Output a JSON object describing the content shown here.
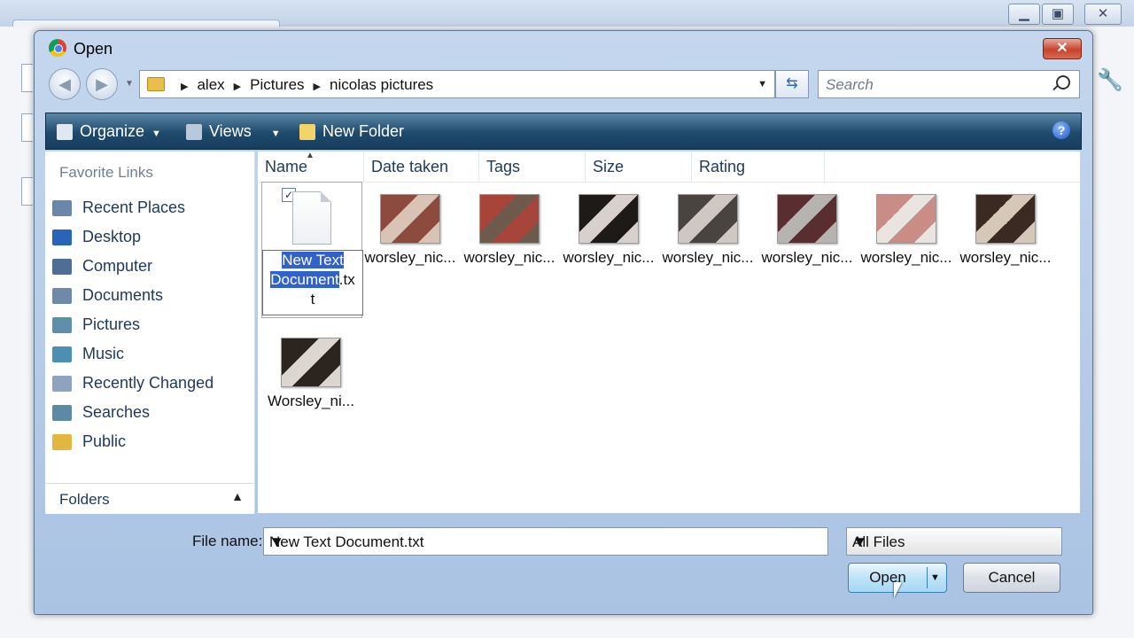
{
  "dialog": {
    "title": "Open",
    "close_label": "✕"
  },
  "nav": {
    "breadcrumb": [
      "alex",
      "Pictures",
      "nicolas pictures"
    ],
    "search_placeholder": "Search"
  },
  "toolbar": {
    "organize": "Organize",
    "views": "Views",
    "new_folder": "New Folder"
  },
  "left_pane": {
    "favorite_links_heading": "Favorite Links",
    "items": [
      {
        "label": "Recent Places",
        "icon": "recent-places-icon",
        "color": "#6a86a8"
      },
      {
        "label": "Desktop",
        "icon": "desktop-icon",
        "color": "#2a64b8"
      },
      {
        "label": "Computer",
        "icon": "computer-icon",
        "color": "#4d6f95"
      },
      {
        "label": "Documents",
        "icon": "documents-icon",
        "color": "#6e8aa8"
      },
      {
        "label": "Pictures",
        "icon": "pictures-icon",
        "color": "#5f8fa8"
      },
      {
        "label": "Music",
        "icon": "music-icon",
        "color": "#4d8fb0"
      },
      {
        "label": "Recently Changed",
        "icon": "recently-changed-icon",
        "color": "#8ea3be"
      },
      {
        "label": "Searches",
        "icon": "searches-icon",
        "color": "#5c8aa4"
      },
      {
        "label": "Public",
        "icon": "public-folder-icon",
        "color": "#e2b640"
      }
    ],
    "folders_label": "Folders"
  },
  "columns": [
    "Name",
    "Date taken",
    "Tags",
    "Size",
    "Rating"
  ],
  "files": {
    "selected": {
      "rename_highlight": "New Text Document",
      "rename_rest_line2": ".tx",
      "rename_rest_line3": "t"
    },
    "thumbs": [
      {
        "name": "worsley_nic...",
        "c1": "#8d4a3e",
        "c2": "#d9c3b5"
      },
      {
        "name": "worsley_nic...",
        "c1": "#a8453a",
        "c2": "#6e5a4c"
      },
      {
        "name": "worsley_nic...",
        "c1": "#1e1a18",
        "c2": "#d8d0cc"
      },
      {
        "name": "worsley_nic...",
        "c1": "#4a4440",
        "c2": "#cfc8c2"
      },
      {
        "name": "worsley_nic...",
        "c1": "#5a2e30",
        "c2": "#b7b3b0"
      },
      {
        "name": "worsley_nic...",
        "c1": "#c98c86",
        "c2": "#e8e4df"
      },
      {
        "name": "worsley_nic...",
        "c1": "#3a2a22",
        "c2": "#d6c8b8"
      },
      {
        "name": "Worsley_ni...",
        "c1": "#2b241f",
        "c2": "#dcd6d0"
      }
    ]
  },
  "bottom": {
    "file_name_label": "File name:",
    "file_name_value": "New Text Document.txt",
    "file_type": "All Files",
    "open_label": "Open",
    "cancel_label": "Cancel"
  }
}
